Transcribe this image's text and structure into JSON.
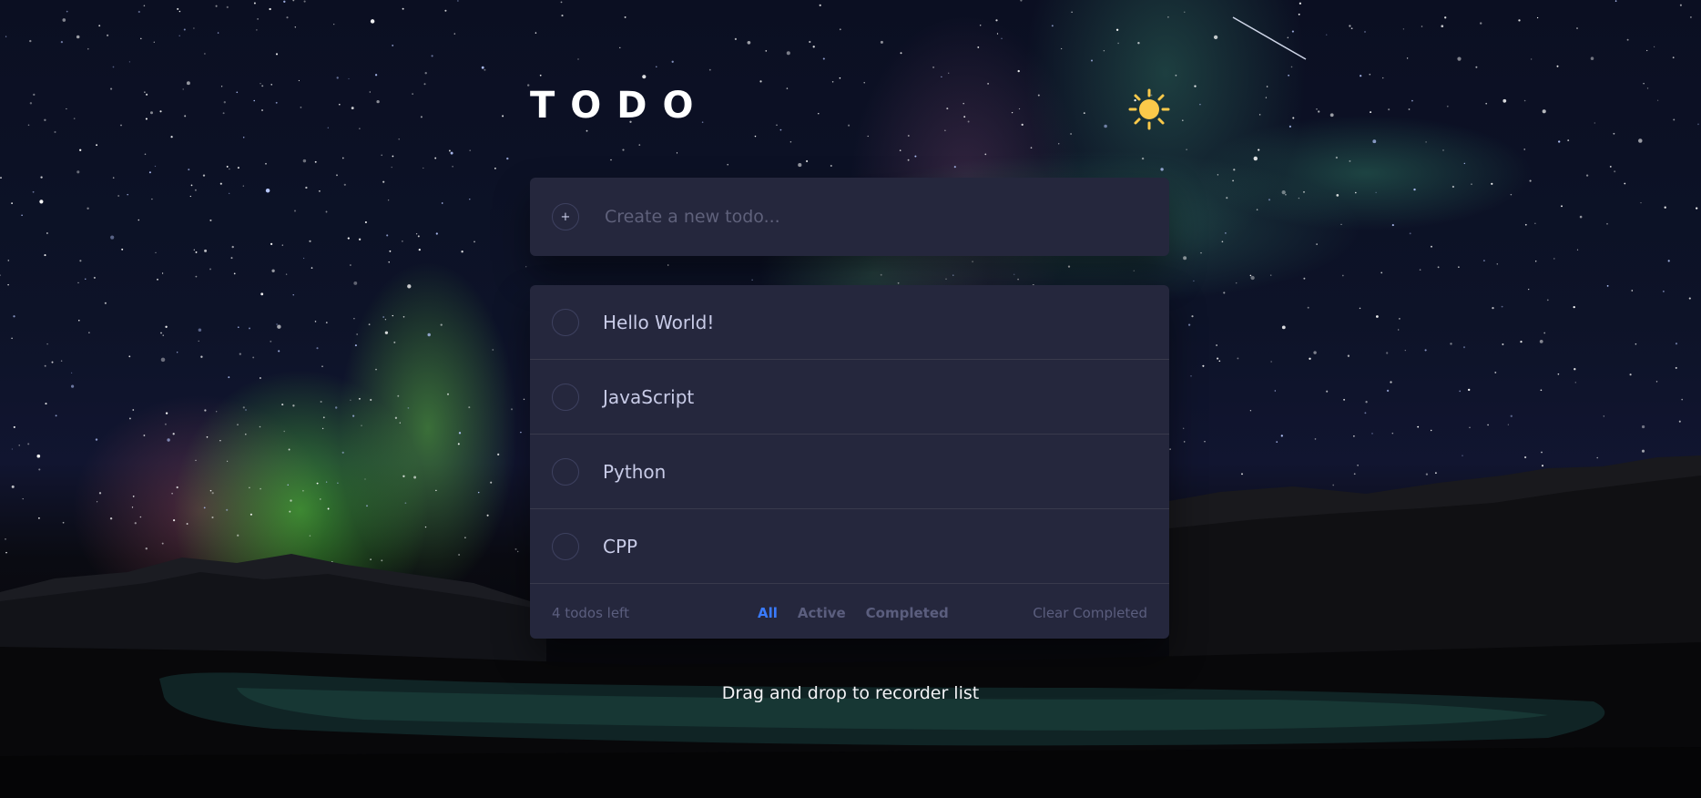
{
  "app": {
    "title": "TODO",
    "theme_toggle_icon": "sun-icon"
  },
  "new_todo": {
    "placeholder": "Create a new todo...",
    "add_icon": "plus-icon"
  },
  "todos": [
    {
      "text": "Hello World!",
      "completed": false
    },
    {
      "text": "JavaScript",
      "completed": false
    },
    {
      "text": "Python",
      "completed": false
    },
    {
      "text": "CPP",
      "completed": false
    }
  ],
  "footer": {
    "count_label": "4 todos left",
    "filters": [
      {
        "label": "All",
        "active": true
      },
      {
        "label": "Active",
        "active": false
      },
      {
        "label": "Completed",
        "active": false
      }
    ],
    "clear_label": "Clear Completed"
  },
  "hint": "Drag and drop to recorder list",
  "colors": {
    "card": "#25273d",
    "text": "#c8cbe7",
    "muted": "#5b5e7e",
    "accent": "#3a7bfd",
    "sun": "#fbc94a"
  }
}
